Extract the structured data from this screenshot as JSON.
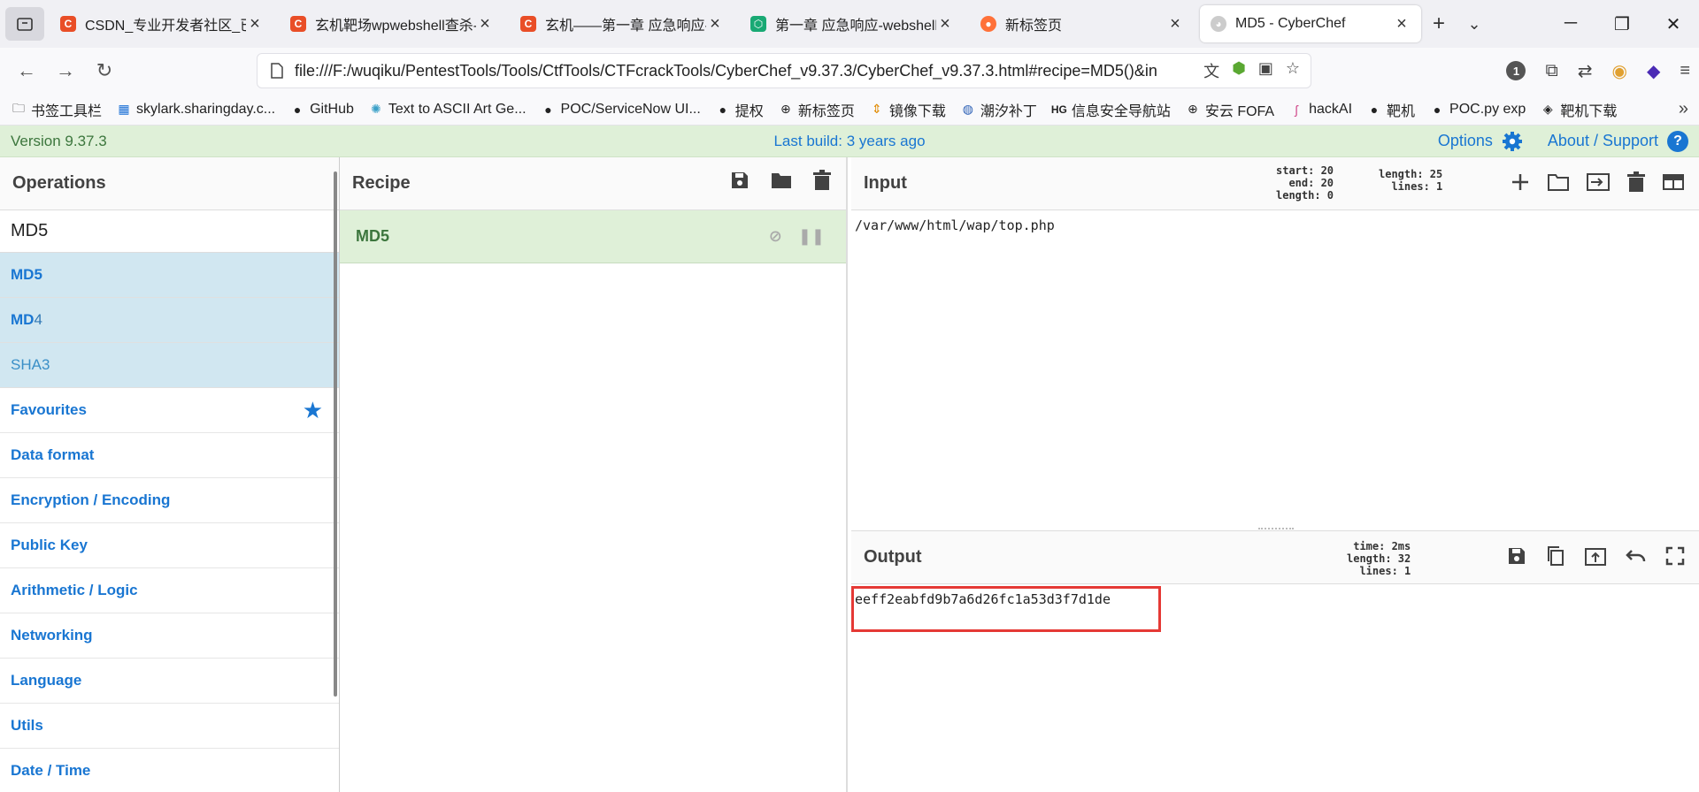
{
  "browser": {
    "tabs": [
      {
        "title": "CSDN_专业开发者社区_已接",
        "favicon_color": "#e94e27",
        "favicon": "C"
      },
      {
        "title": "玄机靶场wpwebshell查杀-",
        "favicon_color": "#e94e27",
        "favicon": "C"
      },
      {
        "title": "玄机——第一章 应急响应-w",
        "favicon_color": "#e94e27",
        "favicon": "C"
      },
      {
        "title": "第一章 应急响应-webshell查",
        "favicon_color": "#19a974",
        "favicon": "⬡"
      },
      {
        "title": "新标签页",
        "favicon_color": "#ff7139",
        "favicon": "●"
      },
      {
        "title": "MD5 - CyberChef",
        "favicon_color": "#bbbbbb",
        "favicon": "◕"
      }
    ],
    "url": "file:///F:/wuqiku/PentestTools/Tools/CtfTools/CTFcrackTools/CyberChef_v9.37.3/CyberChef_v9.37.3.html#recipe=MD5()&in",
    "toolbar_badge": "1",
    "bookmarks": [
      {
        "label": "书签工具栏",
        "icon": "folder-icon"
      },
      {
        "label": "skylark.sharingday.c...",
        "icon": "site-icon"
      },
      {
        "label": "GitHub",
        "icon": "github-icon"
      },
      {
        "label": "Text to ASCII Art Ge...",
        "icon": "react-icon"
      },
      {
        "label": "POC/ServiceNow UI...",
        "icon": "github-icon"
      },
      {
        "label": "提权",
        "icon": "github-icon"
      },
      {
        "label": "新标签页",
        "icon": "globe-icon"
      },
      {
        "label": "镜像下载",
        "icon": "mirror-icon"
      },
      {
        "label": "潮汐补丁",
        "icon": "tide-icon"
      },
      {
        "label": "信息安全导航站",
        "icon": "hg-icon"
      },
      {
        "label": "安云 FOFA",
        "icon": "globe-icon"
      },
      {
        "label": "hackAI",
        "icon": "hack-icon"
      },
      {
        "label": "靶机",
        "icon": "github-icon"
      },
      {
        "label": "POC.py exp",
        "icon": "github-icon"
      },
      {
        "label": "靶机下载",
        "icon": "target-icon"
      }
    ]
  },
  "cyberchef": {
    "version": "Version 9.37.3",
    "last_build": "Last build: 3 years ago",
    "options_label": "Options",
    "about_label": "About / Support",
    "operations": {
      "title": "Operations",
      "search_value": "MD5",
      "results": [
        {
          "hl": "MD5",
          "rest": ""
        },
        {
          "hl": "MD",
          "rest": "4"
        },
        {
          "hl": "SHA3",
          "rest": ""
        }
      ],
      "categories": [
        "Favourites",
        "Data format",
        "Encryption / Encoding",
        "Public Key",
        "Arithmetic / Logic",
        "Networking",
        "Language",
        "Utils",
        "Date / Time"
      ]
    },
    "recipe": {
      "title": "Recipe",
      "operations": [
        "MD5"
      ]
    },
    "input": {
      "title": "Input",
      "value": "/var/www/html/wap/top.php",
      "stats": {
        "start": "start: 20",
        "end": "end: 20",
        "sel_length": "length:  0",
        "length": "length: 25",
        "lines": "lines:  1"
      }
    },
    "output": {
      "title": "Output",
      "value": "eeff2eabfd9b7a6d26fc1a53d3f7d1de",
      "stats": {
        "time": "time:  2ms",
        "length": "length:  32",
        "lines": "lines:   1"
      }
    },
    "colors": {
      "accent": "#1976d2",
      "recipe_bg": "#dff0d8",
      "highlight_box": "#e53935"
    }
  }
}
